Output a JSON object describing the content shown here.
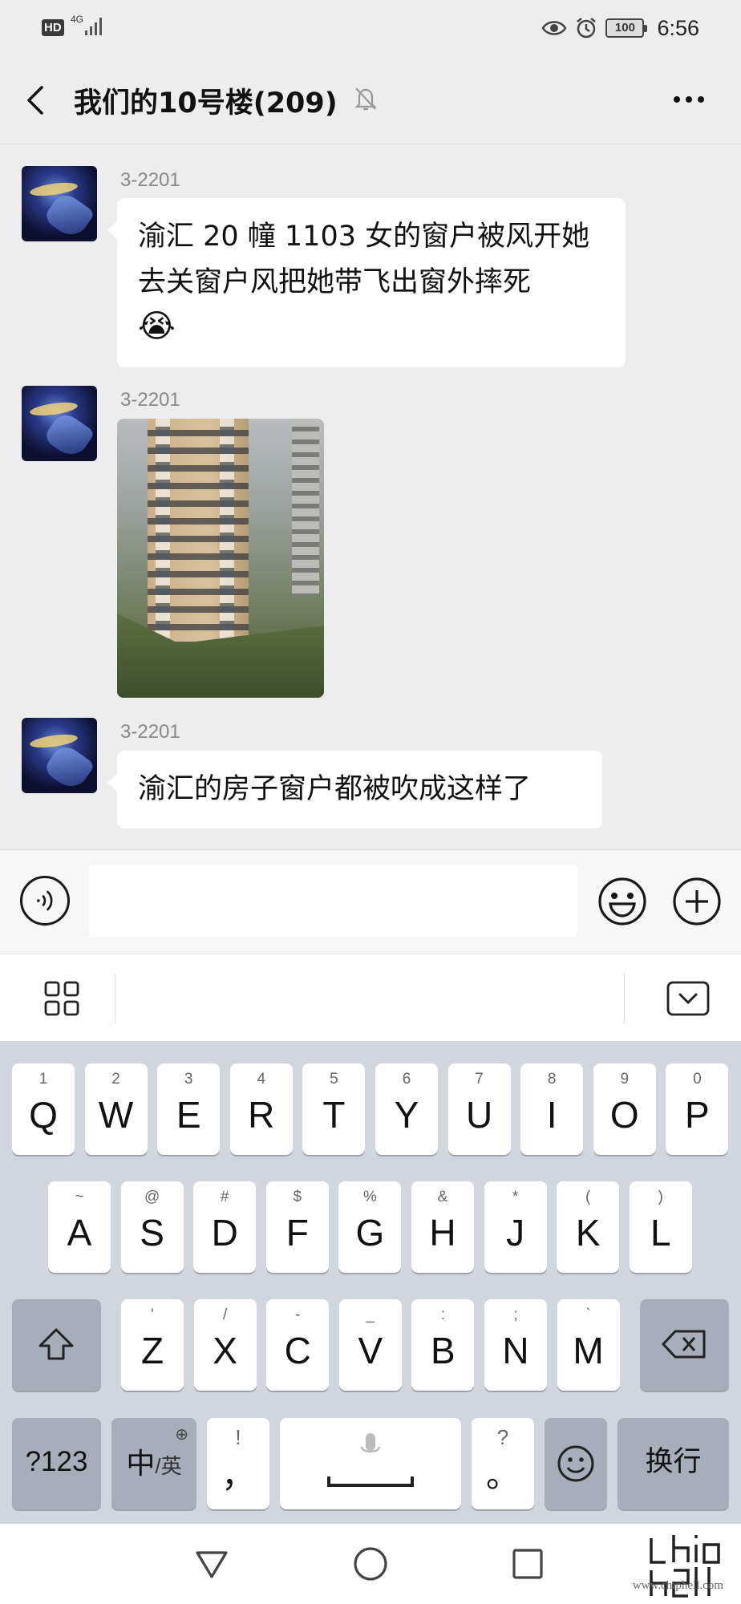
{
  "status_bar": {
    "hd_badge": "HD",
    "network": "4G",
    "battery": "100",
    "time": "6:56"
  },
  "header": {
    "title": "我们的10号楼(209)"
  },
  "messages": [
    {
      "sender": "3-2201",
      "type": "text",
      "text_line1": "渝汇 20 幢 1103 女的窗户被风开她",
      "text_line2": "去关窗户风把她带飞出窗外摔死",
      "emoji": "😭"
    },
    {
      "sender": "3-2201",
      "type": "image"
    },
    {
      "sender": "3-2201",
      "type": "text",
      "text": "渝汇的房子窗户都被吹成这样了"
    }
  ],
  "input": {
    "value": "",
    "placeholder": ""
  },
  "keyboard": {
    "row1": [
      {
        "sub": "1",
        "main": "Q"
      },
      {
        "sub": "2",
        "main": "W"
      },
      {
        "sub": "3",
        "main": "E"
      },
      {
        "sub": "4",
        "main": "R"
      },
      {
        "sub": "5",
        "main": "T"
      },
      {
        "sub": "6",
        "main": "Y"
      },
      {
        "sub": "7",
        "main": "U"
      },
      {
        "sub": "8",
        "main": "I"
      },
      {
        "sub": "9",
        "main": "O"
      },
      {
        "sub": "0",
        "main": "P"
      }
    ],
    "row2": [
      {
        "sub": "~",
        "main": "A"
      },
      {
        "sub": "@",
        "main": "S"
      },
      {
        "sub": "#",
        "main": "D"
      },
      {
        "sub": "$",
        "main": "F"
      },
      {
        "sub": "%",
        "main": "G"
      },
      {
        "sub": "&",
        "main": "H"
      },
      {
        "sub": "*",
        "main": "J"
      },
      {
        "sub": "(",
        "main": "K"
      },
      {
        "sub": ")",
        "main": "L"
      }
    ],
    "row3": [
      {
        "sub": "'",
        "main": "Z"
      },
      {
        "sub": "/",
        "main": "X"
      },
      {
        "sub": "-",
        "main": "C"
      },
      {
        "sub": "_",
        "main": "V"
      },
      {
        "sub": ":",
        "main": "B"
      },
      {
        "sub": ";",
        "main": "N"
      },
      {
        "sub": "`",
        "main": "M"
      }
    ],
    "symbols_key": "?123",
    "lang_key_cn": "中",
    "lang_key_en": "/英",
    "comma_key_sub": "!",
    "comma_key_main": "，",
    "period_key_sub": "?",
    "period_key_main": "。",
    "enter_key": "换行"
  },
  "watermark": {
    "site": "www.chiphell.com"
  },
  "colors": {
    "chat_bg": "#ededed",
    "bubble_bg": "#ffffff",
    "keyboard_bg": "#d1d5dd",
    "key_dark": "#a8aeb9"
  }
}
